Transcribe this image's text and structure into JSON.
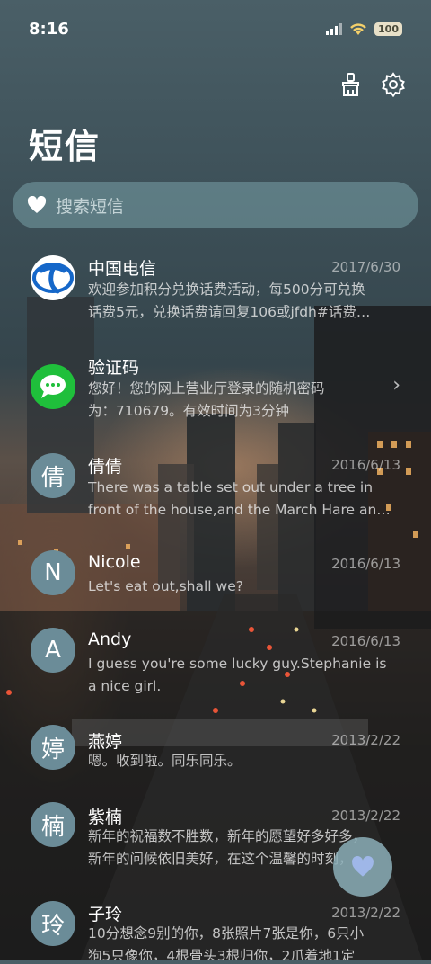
{
  "status": {
    "time": "8:16",
    "battery": "100"
  },
  "header": {
    "title": "短信"
  },
  "search": {
    "placeholder": "搜索短信"
  },
  "conversations": [
    {
      "name": "中国电信",
      "date": "2017/6/30",
      "line1": "欢迎参加积分兑换话费活动，每500分可兑换",
      "line2": "话费5元，兑换话费请回复106或jfdh#话费…",
      "avatar": "",
      "avatar_type": "telecom-logo"
    },
    {
      "name": "验证码",
      "date": "",
      "line1": "您好！您的网上营业厅登录的随机密码",
      "line2": "为：710679。有效时间为3分钟",
      "avatar": "",
      "avatar_type": "message-bubble"
    },
    {
      "name": "倩倩",
      "date": "2016/6/13",
      "line1": "There was a table set out under a tree in",
      "line2": "front of the house,and the March Hare an…",
      "avatar": "倩"
    },
    {
      "name": "Nicole",
      "date": "2016/6/13",
      "line1": "Let's eat out,shall we?",
      "line2": "",
      "avatar": "N"
    },
    {
      "name": "Andy",
      "date": "2016/6/13",
      "line1": "I guess you're some lucky guy.Stephanie is",
      "line2": "a nice girl.",
      "avatar": "A"
    },
    {
      "name": "燕婷",
      "date": "2013/2/22",
      "line1": "嗯。收到啦。同乐同乐。",
      "line2": "",
      "avatar": "婷"
    },
    {
      "name": "紫楠",
      "date": "2013/2/22",
      "line1": "新年的祝福数不胜数，新年的愿望好多好多，",
      "line2": "新年的问候依旧美好，在这个温馨的时刻，…",
      "avatar": "楠"
    },
    {
      "name": "子玲",
      "date": "2013/2/22",
      "line1": "10分想念9别的你，8张照片7张是你，6只小",
      "line2": "狗5只像你，4根骨头3根归你，2爪着地1定",
      "avatar": "玲"
    }
  ],
  "colors": {
    "avatar_bg": "#6b8c98",
    "search_bg": "#78a0a8",
    "fab_bg": "#8cafb9"
  }
}
